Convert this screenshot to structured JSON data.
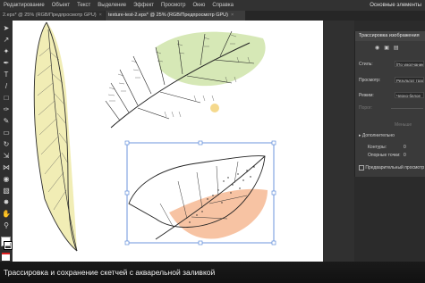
{
  "menubar": {
    "items": [
      "Редактирование",
      "Объект",
      "Текст",
      "Выделение",
      "Эффект",
      "Просмотр",
      "Окно",
      "Справка"
    ],
    "workspace": "Основные элементы"
  },
  "tabs": [
    {
      "label": "2.eps* @ 25% (RGB/Предпросмотр GPU)",
      "close": "×"
    },
    {
      "label": "texture-test-2.eps* @ 25% (RGB/Предпросмотр GPU)",
      "close": "×"
    }
  ],
  "panel": {
    "title": "Трассировка изображения",
    "fields": [
      {
        "label": "Стиль:",
        "value": "[По умолчанию]"
      },
      {
        "label": "Просмотр:",
        "value": "Результат трасс"
      },
      {
        "label": "Режим:",
        "value": "Черно-белое"
      },
      {
        "label": "Порог:",
        "value": ""
      }
    ],
    "fewer": "Меньше",
    "advanced": "Дополнительно",
    "stats": [
      {
        "label": "Контуры:",
        "value": "0"
      },
      {
        "label": "Опорные точки:",
        "value": "0"
      }
    ],
    "preview": "Предварительный просмотр"
  },
  "caption": "Трассировка и сохранение скетчей с акварельной заливкой",
  "colors": {
    "accent": "#1473e6",
    "selection": "#4a7cd6",
    "wash_green": "#b5d57a",
    "wash_yellow": "#e6de78",
    "wash_orange": "#f2a372"
  }
}
